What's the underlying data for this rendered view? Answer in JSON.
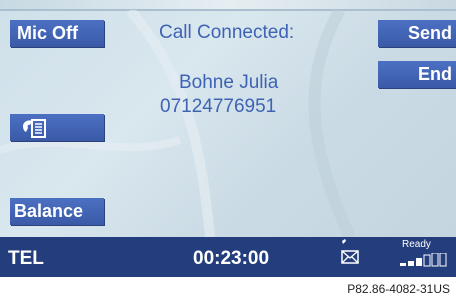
{
  "buttons": {
    "mic_off": "Mic Off",
    "send": "Send",
    "end": "End",
    "balance": "Balance"
  },
  "call": {
    "status": "Call Connected:",
    "name": "Bohne Julia",
    "number": "07124776951"
  },
  "status_bar": {
    "mode": "TEL",
    "duration": "00:23:00",
    "signal_label": "Ready",
    "signal_level": 0.6
  },
  "icons": {
    "phonebook": "phonebook-icon",
    "message": "envelope-icon"
  },
  "caption": "P82.86-4082-31US",
  "colors": {
    "button_blue": "#3f63b4",
    "status_bar": "#243e7d",
    "text_blue": "#3f63b4"
  }
}
